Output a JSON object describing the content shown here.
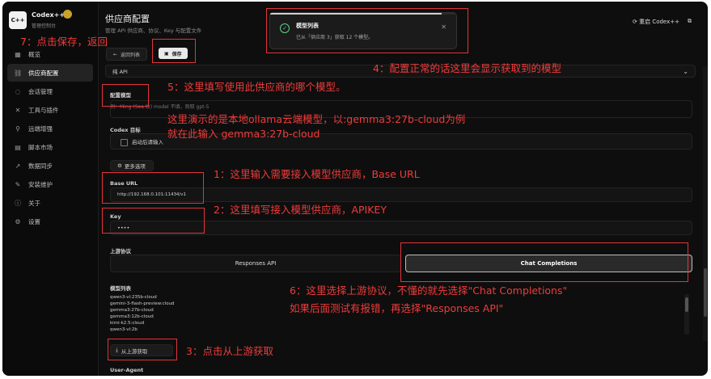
{
  "app": {
    "logo": "C++",
    "name": "Codex++",
    "subtitle": "管理控制台"
  },
  "sidebar": {
    "items": [
      {
        "label": "概览",
        "icon": "grid-icon"
      },
      {
        "label": "供应商配置",
        "icon": "link-icon",
        "active": true
      },
      {
        "label": "会话管理",
        "icon": "chat-icon"
      },
      {
        "label": "工具与插件",
        "icon": "tools-icon"
      },
      {
        "label": "远端增强",
        "icon": "wand-icon"
      },
      {
        "label": "脚本市场",
        "icon": "doc-icon"
      },
      {
        "label": "数据同步",
        "icon": "sync-icon"
      },
      {
        "label": "安装维护",
        "icon": "wrench-icon"
      },
      {
        "label": "关于",
        "icon": "info-icon"
      },
      {
        "label": "设置",
        "icon": "gear-icon"
      }
    ]
  },
  "header": {
    "title": "供应商配置",
    "subtitle": "管理 API 供应商、协议、Key 与配置文件",
    "right_label": "重启 Codex++"
  },
  "toolbar": {
    "back_label": "返回列表",
    "save_label": "保存"
  },
  "toast": {
    "title": "模型列表",
    "text": "已从「供应商 3」获取 12 个模型。",
    "progress": 0.92
  },
  "form": {
    "api_mode": "纯 API",
    "config_model_label": "配置模型",
    "config_model_hint": "例：Ming (Sea 收) model 不填，则取 gpt-5",
    "codex_label": "Codex 目标",
    "codex_checkbox": "启动后请输入",
    "more_options": "更多选项",
    "base_url_label": "Base URL",
    "base_url_value": "http://192.168.0.101:11434/v1",
    "key_label": "Key",
    "key_value": "••••",
    "protocol_label": "上游协议",
    "protocol_options": [
      "Responses API",
      "Chat Completions"
    ],
    "protocol_selected": "Chat Completions",
    "models_label": "模型列表",
    "models": [
      "qwen3-vl:235b-cloud",
      "gemini-3-flash-preview:cloud",
      "gemma3:27b-cloud",
      "gemma3:12b-cloud",
      "kimi-k2.5:cloud",
      "qwen3-vl:2b"
    ],
    "fetch_label": "从上游获取",
    "user_agent_label": "User-Agent"
  },
  "annotations": {
    "a7": "7：点击保存，返回",
    "a4": "4：配置正常的话这里会显示获取到的模型",
    "a5": "5：这里填写使用此供应商的哪个模型。",
    "a5b": "这里演示的是本地ollama云端模型，以:gemma3:27b-cloud为例",
    "a5c": "就在此输入 gemma3:27b-cloud",
    "a1": "1：这里输入需要接入模型供应商，Base URL",
    "a2": "2：这里填写接入模型供应商，APIKEY",
    "a6": "6：这里选择上游协议，不懂的就先选择\"Chat Completions\"",
    "a6b": "如果后面测试有报错，再选择\"Responses API\"",
    "a3": "3：点击从上游获取"
  },
  "colors": {
    "annotation": "#e0353b",
    "accent": "#5fd38d",
    "background": "#0e0e0e"
  }
}
